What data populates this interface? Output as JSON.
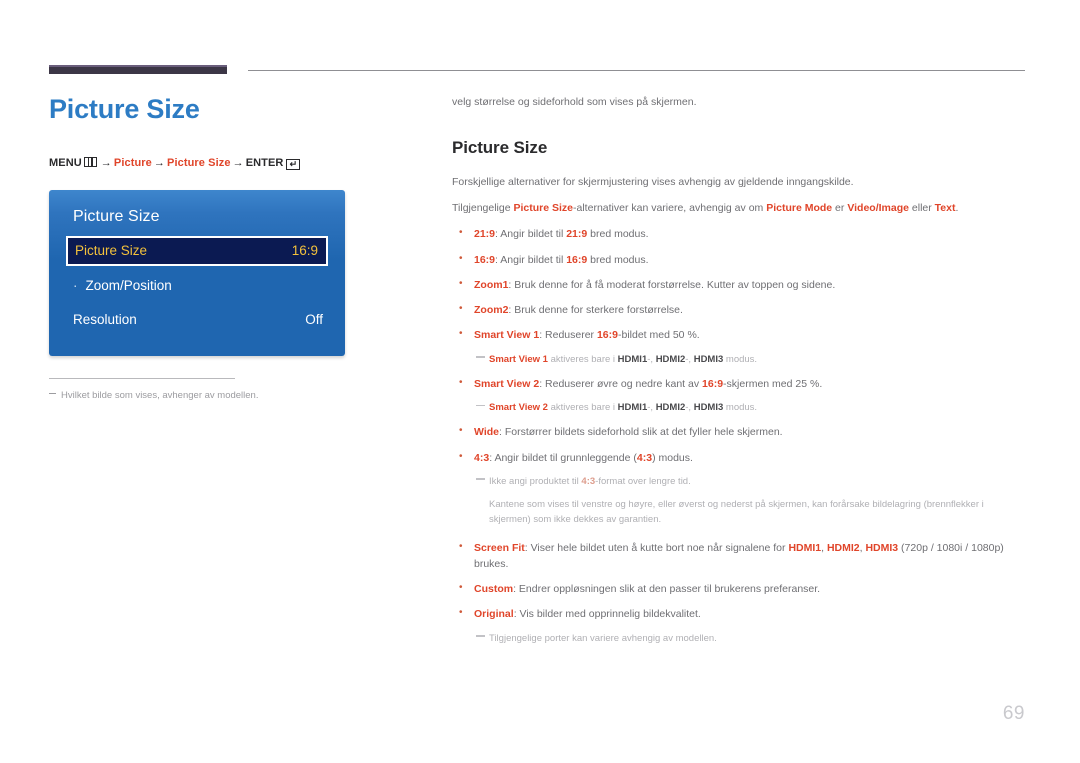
{
  "header": {
    "accent_color": "#3c3646",
    "rule_color": "#8f8f93"
  },
  "left": {
    "title": "Picture Size",
    "title_color": "#2d7cc4",
    "menu_path": {
      "menu_label": "MENU",
      "menu_icon": "menu-bars-icon",
      "arrow": "→",
      "step1": "Picture",
      "step2": "Picture Size",
      "enter_label": "ENTER",
      "enter_icon": "↵"
    },
    "osd": {
      "title": "Picture Size",
      "rows": [
        {
          "label": "Picture Size",
          "value": "16:9",
          "selected": true,
          "sub": false
        },
        {
          "label": "Zoom/Position",
          "value": "",
          "selected": false,
          "sub": true
        },
        {
          "label": "Resolution",
          "value": "Off",
          "selected": false,
          "sub": false
        }
      ],
      "bg_color": "#1f66b0",
      "selected_bg": "#0b1a52",
      "selected_text": "#f3c13c"
    },
    "footnote": "Hvilket bilde som vises, avhenger av modellen."
  },
  "right": {
    "intro": "velg størrelse og sideforhold som vises på skjermen.",
    "section_title": "Picture Size",
    "para1": "Forskjellige alternativer for skjermjustering vises avhengig av gjeldende inngangskilde.",
    "para2": {
      "a": "Tilgjengelige ",
      "b_hl": "Picture Size",
      "c": "-alternativer kan variere, avhengig av om ",
      "d_hl": "Picture Mode",
      "e": " er ",
      "f_hl": "Video/Image",
      "g": " eller ",
      "h_hl": "Text",
      "i": "."
    },
    "bullets": [
      {
        "term": "21:9",
        "text_a": ": Angir bildet til ",
        "term2": "21:9",
        "text_b": " bred modus."
      },
      {
        "term": "16:9",
        "text_a": ": Angir bildet til ",
        "term2": "16:9",
        "text_b": " bred modus."
      },
      {
        "term": "Zoom1",
        "text_a": ": Bruk denne for å få moderat forstørrelse. Kutter av toppen og sidene.",
        "term2": "",
        "text_b": ""
      },
      {
        "term": "Zoom2",
        "text_a": ": Bruk denne for sterkere forstørrelse.",
        "term2": "",
        "text_b": ""
      },
      {
        "term": "Smart View 1",
        "text_a": ": Reduserer ",
        "term2": "16:9",
        "text_b": "-bildet med 50 %."
      }
    ],
    "subnote1": {
      "lead": "Smart View 1",
      "mid": " aktiveres bare i ",
      "p1": "HDMI1",
      "s1": "-, ",
      "p2": "HDMI2",
      "s2": "-, ",
      "p3": "HDMI3",
      "tail": " modus."
    },
    "bullet_sv2": {
      "term": "Smart View 2",
      "text_a": ": Reduserer øvre og nedre kant av ",
      "term2": "16:9",
      "text_b": "-skjermen med 25 %."
    },
    "subnote2": {
      "lead": "Smart View 2",
      "mid": " aktiveres bare i ",
      "p1": "HDMI1",
      "s1": "-, ",
      "p2": "HDMI2",
      "s2": "-, ",
      "p3": "HDMI3",
      "tail": " modus."
    },
    "bullet_wide": {
      "term": "Wide",
      "text_a": ": Forstørrer bildets sideforhold slik at det fyller hele skjermen.",
      "term2": "",
      "text_b": ""
    },
    "bullet_43": {
      "term": "4:3",
      "text_a": ": Angir bildet til grunnleggende (",
      "term2": "4:3",
      "text_b": ") modus."
    },
    "subnote3": {
      "a": "Ikke angi produktet til ",
      "hl": "4:3",
      "b": "-format over lengre tid.",
      "cont": "Kantene som vises til venstre og høyre, eller øverst og nederst på skjermen, kan forårsake bildelagring (brennflekker i skjermen) som ikke dekkes av garantien."
    },
    "bullet_screenfit": {
      "term": "Screen Fit",
      "text_a": ": Viser hele bildet uten å kutte bort noe når signalene for ",
      "p1": "HDMI1",
      "s1": ", ",
      "p2": "HDMI2",
      "s2": ", ",
      "p3": "HDMI3",
      "tail": " (720p / 1080i / 1080p) brukes."
    },
    "bullet_custom": {
      "term": "Custom",
      "text_a": ": Endrer oppløsningen slik at den passer til brukerens preferanser.",
      "term2": "",
      "text_b": ""
    },
    "bullet_original": {
      "term": "Original",
      "text_a": ": Vis bilder med opprinnelig bildekvalitet.",
      "term2": "",
      "text_b": ""
    },
    "subnote4": "Tilgjengelige porter kan variere avhengig av modellen.",
    "highlight_color": "#e0452a"
  },
  "page_number": "69"
}
